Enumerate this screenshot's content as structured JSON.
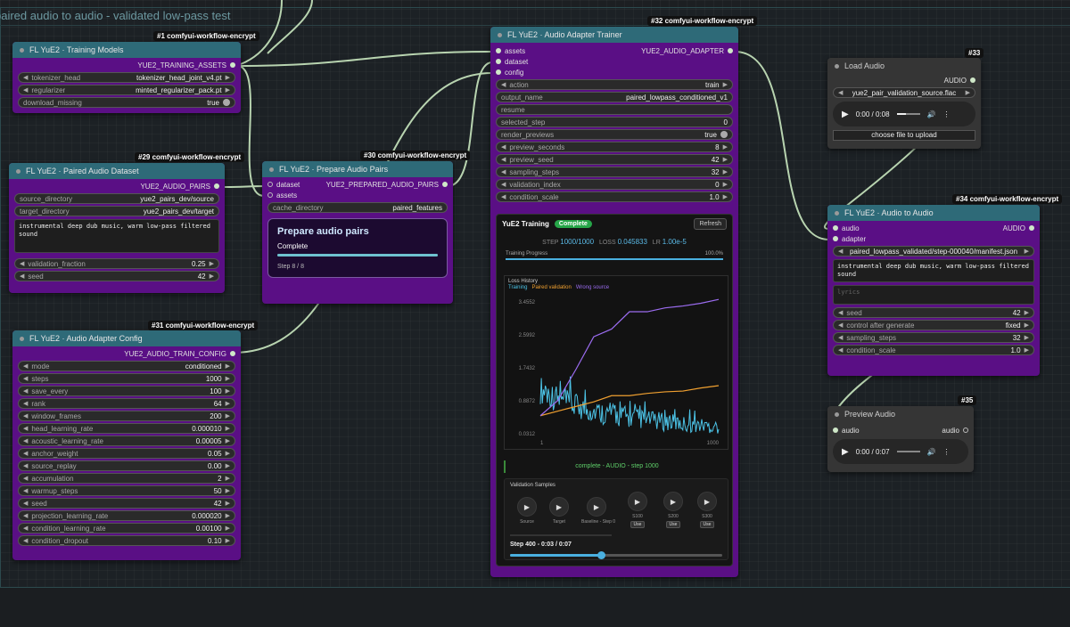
{
  "group": {
    "title": "paired audio to audio - validated low-pass test"
  },
  "node1": {
    "badge": "#1 comfyui-workflow-encrypt",
    "title": "FL YuE2 · Training Models",
    "output": "YUE2_TRAINING_ASSETS",
    "widgets": [
      {
        "label": "tokenizer_head",
        "value": "tokenizer_head_joint_v4.pt"
      },
      {
        "label": "regularizer",
        "value": "minted_regularizer_pack.pt"
      }
    ],
    "toggle": {
      "label": "download_missing",
      "value": "true"
    }
  },
  "node29": {
    "badge": "#29 comfyui-workflow-encrypt",
    "title": "FL YuE2 · Paired Audio Dataset",
    "output": "YUE2_AUDIO_PAIRS",
    "widgets": [
      {
        "label": "source_directory",
        "value": "yue2_pairs_dev/source"
      },
      {
        "label": "target_directory",
        "value": "yue2_pairs_dev/target"
      }
    ],
    "text": "instrumental deep dub music, warm low-pass filtered sound",
    "numbers": [
      {
        "label": "validation_fraction",
        "value": "0.25"
      },
      {
        "label": "seed",
        "value": "42"
      }
    ]
  },
  "node30": {
    "badge": "#30 comfyui-workflow-encrypt",
    "title": "FL YuE2 · Prepare Audio Pairs",
    "inputs": [
      "dataset",
      "assets"
    ],
    "output": "YUE2_PREPARED_AUDIO_PAIRS",
    "widget": {
      "label": "cache_directory",
      "value": "paired_features"
    },
    "card": {
      "title": "Prepare audio pairs",
      "status": "Complete",
      "progress": 1.0,
      "step": "Step 8 / 8"
    }
  },
  "node31": {
    "badge": "#31 comfyui-workflow-encrypt",
    "title": "FL YuE2 · Audio Adapter Config",
    "output": "YUE2_AUDIO_TRAIN_CONFIG",
    "widgets": [
      {
        "label": "mode",
        "value": "conditioned"
      },
      {
        "label": "steps",
        "value": "1000"
      },
      {
        "label": "save_every",
        "value": "100"
      },
      {
        "label": "rank",
        "value": "64"
      },
      {
        "label": "window_frames",
        "value": "200"
      },
      {
        "label": "head_learning_rate",
        "value": "0.000010"
      },
      {
        "label": "acoustic_learning_rate",
        "value": "0.00005"
      },
      {
        "label": "anchor_weight",
        "value": "0.05"
      },
      {
        "label": "source_replay",
        "value": "0.00"
      },
      {
        "label": "accumulation",
        "value": "2"
      },
      {
        "label": "warmup_steps",
        "value": "50"
      },
      {
        "label": "seed",
        "value": "42"
      },
      {
        "label": "projection_learning_rate",
        "value": "0.000020"
      },
      {
        "label": "condition_learning_rate",
        "value": "0.00100"
      },
      {
        "label": "condition_dropout",
        "value": "0.10"
      }
    ]
  },
  "node32": {
    "badge": "#32 comfyui-workflow-encrypt",
    "title": "FL YuE2 · Audio Adapter Trainer",
    "inputs": [
      "assets",
      "dataset",
      "config"
    ],
    "output": "YUE2_AUDIO_ADAPTER",
    "widgets": [
      {
        "label": "action",
        "value": "train",
        "kind": "combo"
      },
      {
        "label": "output_name",
        "value": "paired_lowpass_conditioned_v1",
        "kind": "text"
      },
      {
        "label": "resume",
        "value": "",
        "kind": "text"
      },
      {
        "label": "selected_step",
        "value": "0",
        "kind": "text"
      },
      {
        "label": "render_previews",
        "value": "true",
        "kind": "toggle"
      },
      {
        "label": "preview_seconds",
        "value": "8",
        "kind": "combo"
      },
      {
        "label": "preview_seed",
        "value": "42",
        "kind": "combo"
      },
      {
        "label": "sampling_steps",
        "value": "32",
        "kind": "combo"
      },
      {
        "label": "validation_index",
        "value": "0",
        "kind": "combo"
      },
      {
        "label": "condition_scale",
        "value": "1.0",
        "kind": "combo"
      }
    ],
    "panel": {
      "title": "YuE2 Training",
      "pill": "Complete",
      "refresh": "Refresh",
      "step_label": "STEP",
      "step_value": "1000/1000",
      "loss_label": "LOSS",
      "loss_value": "0.045833",
      "lr_label": "LR",
      "lr_value": "1.00e-5",
      "progress_label": "Training Progress",
      "progress_pct": "100.0%",
      "progress": 1.0,
      "loss_title": "Loss History",
      "legend": [
        {
          "name": "Training",
          "color": "#4cc3e6"
        },
        {
          "name": "Paired validation",
          "color": "#f0a030"
        },
        {
          "name": "Wrong source",
          "color": "#9b6cf0"
        }
      ],
      "status": "complete - AUDIO - step 1000",
      "validation_title": "Validation Samples",
      "samples": [
        {
          "label": "Source",
          "use": ""
        },
        {
          "label": "Target",
          "use": ""
        },
        {
          "label": "Baseline - Step 0",
          "use": ""
        },
        {
          "label": "S100",
          "use": "Use"
        },
        {
          "label": "S200",
          "use": "Use"
        },
        {
          "label": "S300",
          "use": "Use"
        }
      ],
      "playback": "Step 400 - 0:03 / 0:07",
      "playback_progress": 0.43
    }
  },
  "chart_data": {
    "type": "line",
    "title": "Loss History",
    "xlabel": "",
    "ylabel": "",
    "xlim": [
      1,
      1000
    ],
    "ylim": [
      0.0312,
      3.4552
    ],
    "yticks": [
      "3.4552",
      "2.5992",
      "1.7432",
      "0.8872",
      "0.0312"
    ],
    "xticks": [
      "1",
      "1000"
    ],
    "series": [
      {
        "name": "Training",
        "color": "#4cc3e6",
        "x": [
          1,
          50,
          100,
          150,
          200,
          300,
          400,
          500,
          600,
          700,
          800,
          900,
          1000
        ],
        "y": [
          0.95,
          0.85,
          0.72,
          0.62,
          0.55,
          0.45,
          0.38,
          0.32,
          0.28,
          0.25,
          0.22,
          0.2,
          0.18
        ]
      },
      {
        "name": "Paired validation",
        "color": "#f0a030",
        "x": [
          1,
          100,
          200,
          300,
          400,
          500,
          600,
          700,
          800,
          900,
          1000
        ],
        "y": [
          0.5,
          0.62,
          0.74,
          0.86,
          1.02,
          1.02,
          1.08,
          1.12,
          1.14,
          1.22,
          1.28
        ]
      },
      {
        "name": "Wrong source",
        "color": "#9b6cf0",
        "x": [
          1,
          100,
          200,
          300,
          400,
          500,
          600,
          700,
          800,
          900,
          1000
        ],
        "y": [
          0.5,
          0.9,
          1.7,
          2.55,
          2.75,
          3.2,
          3.2,
          3.3,
          3.35,
          3.42,
          3.52
        ]
      }
    ],
    "grid": false,
    "legend": "top-left"
  },
  "node33": {
    "badge": "#33",
    "title": "Load Audio",
    "output": "AUDIO",
    "file": "yue2_pair_validation_source.flac",
    "time": "0:00 / 0:08",
    "upload": "choose file to upload"
  },
  "node34": {
    "badge": "#34 comfyui-workflow-encrypt",
    "title": "FL YuE2 · Audio to Audio",
    "inputs": [
      "audio",
      "adapter"
    ],
    "output": "AUDIO",
    "adapter_value": "paired_lowpass_validated/step-000040/manifest.json",
    "text": "instrumental deep dub music, warm low-pass filtered sound",
    "lyrics_placeholder": "lyrics",
    "widgets": [
      {
        "label": "seed",
        "value": "42"
      },
      {
        "label": "control after generate",
        "value": "fixed"
      },
      {
        "label": "sampling_steps",
        "value": "32"
      },
      {
        "label": "condition_scale",
        "value": "1.0"
      }
    ]
  },
  "node35": {
    "badge": "#35",
    "title": "Preview Audio",
    "input": "audio",
    "output": "audio",
    "time": "0:00 / 0:07"
  }
}
